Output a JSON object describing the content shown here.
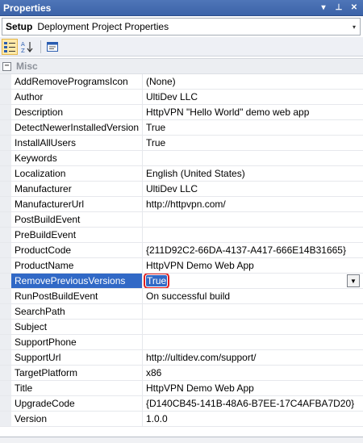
{
  "window": {
    "title": "Properties",
    "dropdown_glyph": "▾",
    "pin_glyph": "⊥",
    "close_glyph": "✕"
  },
  "object_selector": {
    "bold_label": "Setup",
    "name": "Deployment Project Properties",
    "arrow_glyph": "▾"
  },
  "toolbar": {
    "buttons": [
      {
        "icon": "categorized-icon",
        "active": true
      },
      {
        "icon": "alphabetical-icon",
        "active": false
      },
      {
        "icon": "property-pages-icon",
        "active": false
      }
    ]
  },
  "grid": {
    "category": {
      "label": "Misc",
      "toggle_glyph": "−"
    },
    "rows": [
      {
        "name": "AddRemoveProgramsIcon",
        "value": "(None)"
      },
      {
        "name": "Author",
        "value": "UltiDev LLC"
      },
      {
        "name": "Description",
        "value": "HttpVPN \"Hello World\" demo web app"
      },
      {
        "name": "DetectNewerInstalledVersion",
        "value": "True"
      },
      {
        "name": "InstallAllUsers",
        "value": "True"
      },
      {
        "name": "Keywords",
        "value": ""
      },
      {
        "name": "Localization",
        "value": "English (United States)"
      },
      {
        "name": "Manufacturer",
        "value": "UltiDev LLC"
      },
      {
        "name": "ManufacturerUrl",
        "value": "http://httpvpn.com/"
      },
      {
        "name": "PostBuildEvent",
        "value": ""
      },
      {
        "name": "PreBuildEvent",
        "value": ""
      },
      {
        "name": "ProductCode",
        "value": "{211D92C2-66DA-4137-A417-666E14B31665}"
      },
      {
        "name": "ProductName",
        "value": "HttpVPN Demo Web App"
      },
      {
        "name": "RemovePreviousVersions",
        "value": "True",
        "selected": true,
        "dropdown_glyph": "▼"
      },
      {
        "name": "RunPostBuildEvent",
        "value": "On successful build"
      },
      {
        "name": "SearchPath",
        "value": ""
      },
      {
        "name": "Subject",
        "value": ""
      },
      {
        "name": "SupportPhone",
        "value": ""
      },
      {
        "name": "SupportUrl",
        "value": "http://ultidev.com/support/"
      },
      {
        "name": "TargetPlatform",
        "value": "x86"
      },
      {
        "name": "Title",
        "value": "HttpVPN Demo Web App"
      },
      {
        "name": "UpgradeCode",
        "value": "{D140CB45-141B-48A6-B7EE-17C4AFBA7D20}"
      },
      {
        "name": "Version",
        "value": "1.0.0"
      }
    ]
  },
  "colors": {
    "titlebar": "#3b63a8",
    "selection": "#3169c6",
    "highlight_circle": "#e02020"
  }
}
